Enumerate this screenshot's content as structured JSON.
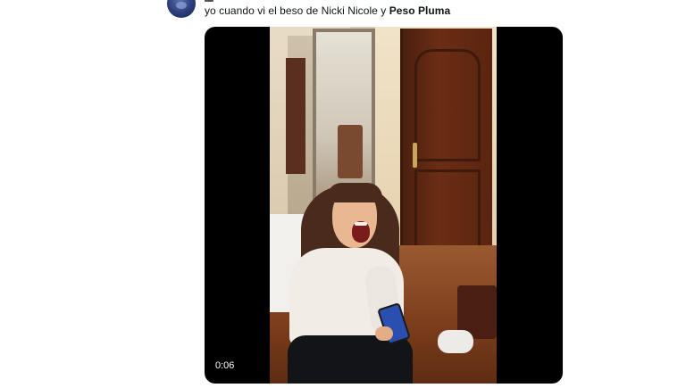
{
  "tweet": {
    "text_plain": "yo cuando vi el beso de Nicki Nicole y ",
    "text_bold": "Peso Pluma"
  },
  "video": {
    "timestamp": "0:06"
  },
  "colors": {
    "text": "#0f1419",
    "media_background": "#000000",
    "page_background": "#ffffff"
  },
  "icons": {
    "avatar": "profile-avatar"
  }
}
